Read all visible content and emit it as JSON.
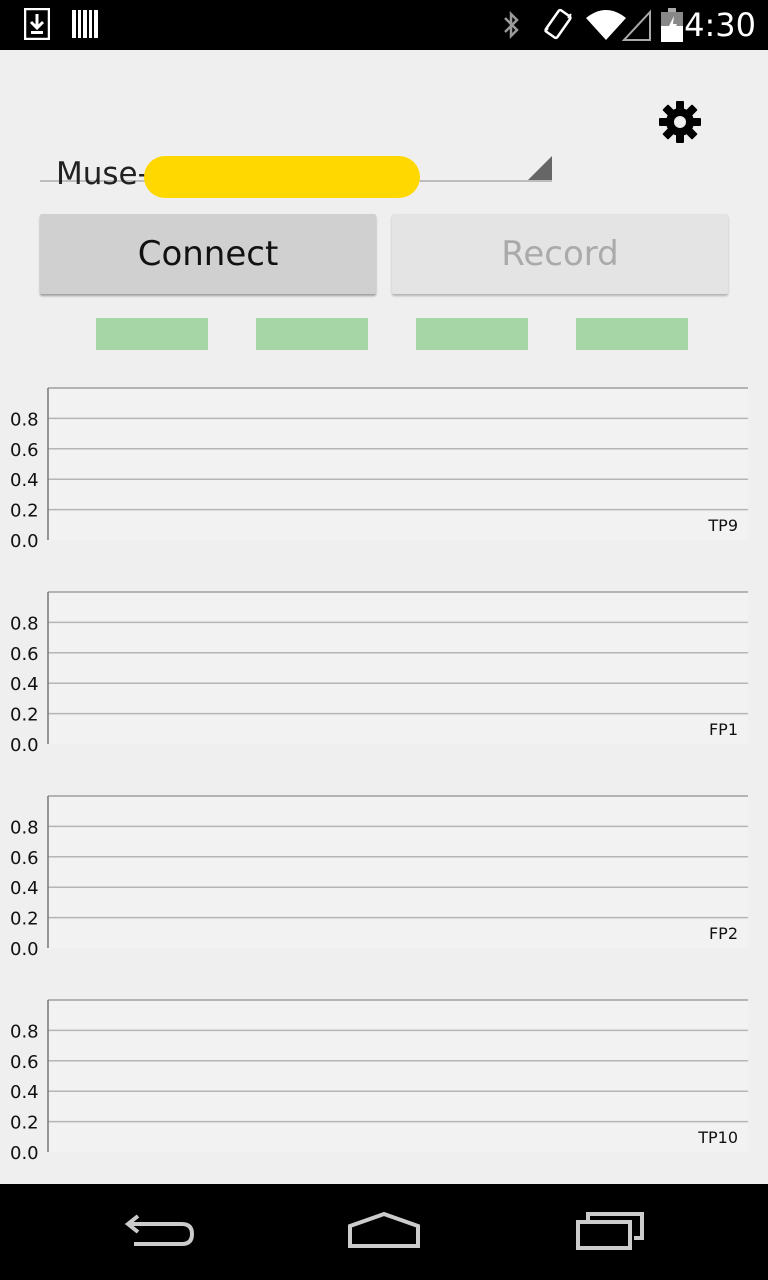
{
  "status_bar": {
    "time": "4:30",
    "icons": [
      "download-icon",
      "barcode-icon",
      "bluetooth-icon",
      "vibrate-icon",
      "wifi-icon",
      "signal-icon",
      "battery-charging-icon"
    ]
  },
  "device_spinner": {
    "value_prefix": "Muse-"
  },
  "buttons": {
    "connect": "Connect",
    "record": "Record"
  },
  "colors": {
    "indicator": "#a6d6a6",
    "redaction": "#ffd800",
    "grid": "#b5b5b5",
    "axis": "#777777"
  },
  "charts": [
    {
      "label": "TP9",
      "y_ticks": [
        "0.8",
        "0.6",
        "0.4",
        "0.2",
        "0.0"
      ]
    },
    {
      "label": "FP1",
      "y_ticks": [
        "0.8",
        "0.6",
        "0.4",
        "0.2",
        "0.0"
      ]
    },
    {
      "label": "FP2",
      "y_ticks": [
        "0.8",
        "0.6",
        "0.4",
        "0.2",
        "0.0"
      ]
    },
    {
      "label": "TP10",
      "y_ticks": [
        "0.8",
        "0.6",
        "0.4",
        "0.2",
        "0.0"
      ]
    }
  ],
  "chart_data": [
    {
      "type": "line",
      "title": "TP9",
      "ylim": [
        0,
        1
      ],
      "series": [],
      "grid": true
    },
    {
      "type": "line",
      "title": "FP1",
      "ylim": [
        0,
        1
      ],
      "series": [],
      "grid": true
    },
    {
      "type": "line",
      "title": "FP2",
      "ylim": [
        0,
        1
      ],
      "series": [],
      "grid": true
    },
    {
      "type": "line",
      "title": "TP10",
      "ylim": [
        0,
        1
      ],
      "series": [],
      "grid": true
    }
  ]
}
